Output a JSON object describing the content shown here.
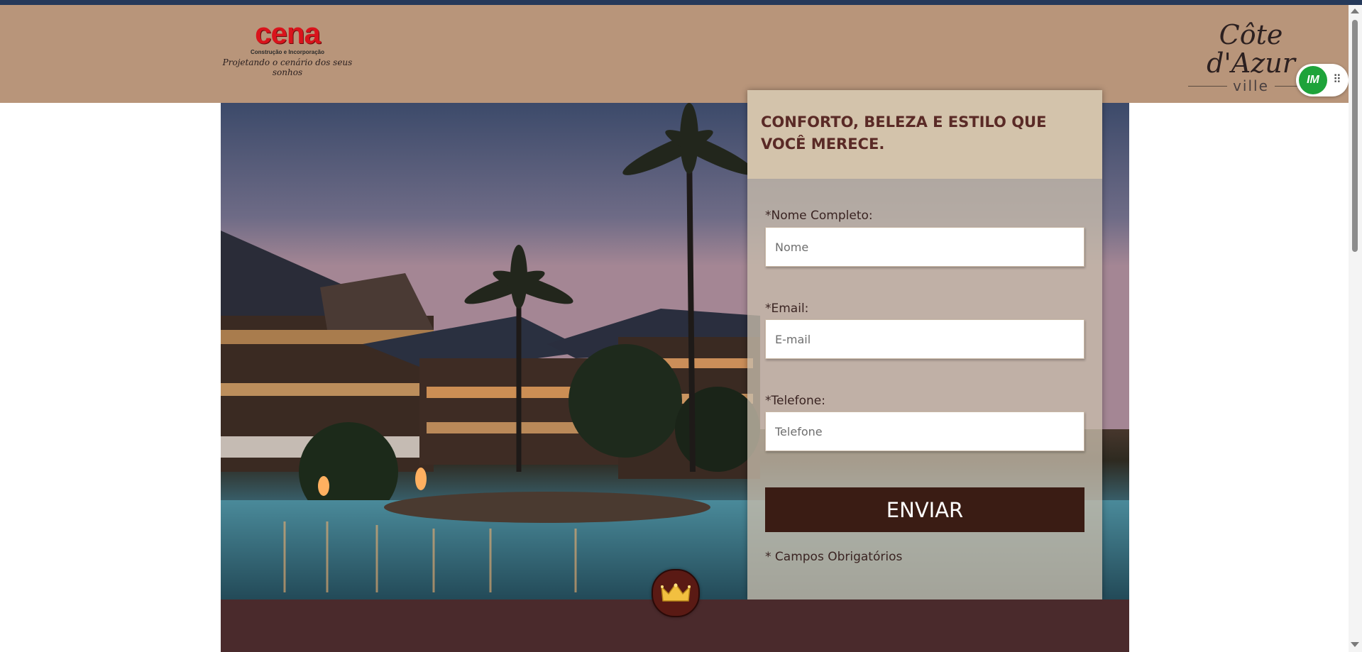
{
  "header": {
    "brand": {
      "name": "cena",
      "subtitle": "Construção e Incorporação",
      "tagline": "Projetando o cenário dos seus sonhos"
    },
    "development_logo": {
      "name": "Côte d'Azur",
      "sub": "ville"
    },
    "extension_widget": {
      "label": "IM",
      "icon": "drag-handle-icon"
    }
  },
  "form": {
    "title": "CONFORTO, BELEZA E ESTILO QUE VOCÊ MERECE.",
    "fields": [
      {
        "label": "*Nome Completo:",
        "placeholder": "Nome",
        "value": ""
      },
      {
        "label": "*Email:",
        "placeholder": "E-mail",
        "value": ""
      },
      {
        "label": "*Telefone:",
        "placeholder": "Telefone",
        "value": ""
      }
    ],
    "submit_label": "ENVIAR",
    "required_note": "* Campos Obrigatórios"
  },
  "badge": {
    "icon": "crown-icon"
  },
  "colors": {
    "header_bg": "#b8957a",
    "form_head_bg": "#d3c3ab",
    "button_bg": "#3a1c14",
    "bottom_band": "#4a2a2c",
    "title_text": "#5a2a26",
    "widget_green": "#1ea33a"
  }
}
